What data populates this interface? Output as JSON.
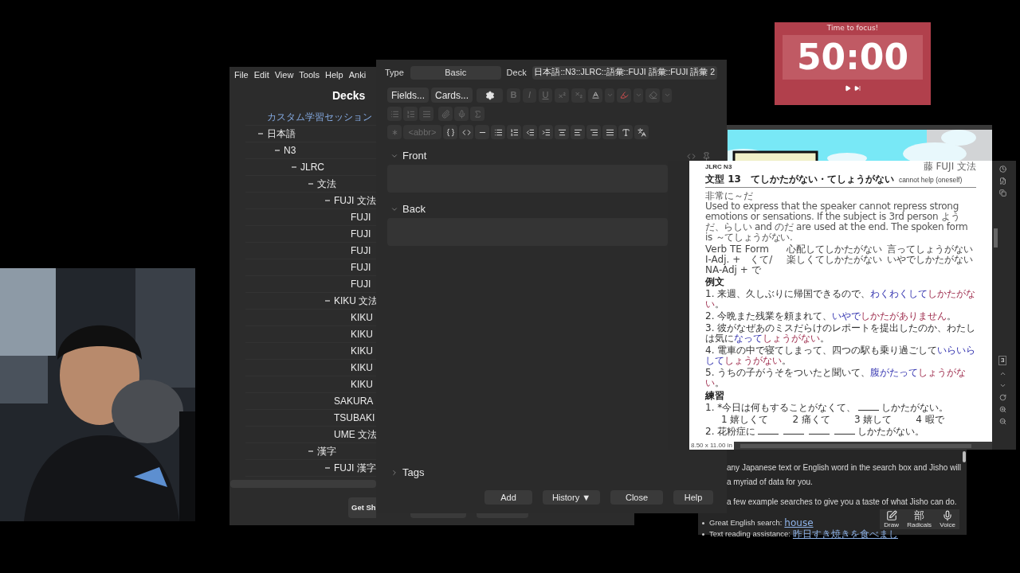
{
  "deck_browser": {
    "menu": [
      "File",
      "Edit",
      "View",
      "Tools",
      "Help",
      "Anki"
    ],
    "title": "Decks",
    "tree": [
      {
        "name": "カスタム学習セッション",
        "kind": "filtered"
      },
      {
        "name": "日本語",
        "kind": "deck",
        "expanded": true,
        "children": [
          {
            "name": "N3",
            "kind": "deck",
            "expanded": true,
            "children": [
              {
                "name": "JLRC",
                "kind": "deck",
                "expanded": true,
                "children": [
                  {
                    "name": "文法",
                    "kind": "deck",
                    "expanded": true,
                    "children": [
                      {
                        "name": "FUJI 文法",
                        "kind": "deck",
                        "expanded": true,
                        "children": [
                          {
                            "name": "FUJI",
                            "kind": "deck"
                          },
                          {
                            "name": "FUJI",
                            "kind": "deck"
                          },
                          {
                            "name": "FUJI",
                            "kind": "deck"
                          },
                          {
                            "name": "FUJI",
                            "kind": "deck"
                          },
                          {
                            "name": "FUJI",
                            "kind": "deck"
                          }
                        ]
                      },
                      {
                        "name": "KIKU 文法",
                        "kind": "deck",
                        "expanded": true,
                        "children": [
                          {
                            "name": "KIKU",
                            "kind": "deck"
                          },
                          {
                            "name": "KIKU",
                            "kind": "deck"
                          },
                          {
                            "name": "KIKU",
                            "kind": "deck"
                          },
                          {
                            "name": "KIKU",
                            "kind": "deck"
                          },
                          {
                            "name": "KIKU",
                            "kind": "deck"
                          }
                        ]
                      },
                      {
                        "name": "SAKURA",
                        "kind": "deck"
                      },
                      {
                        "name": "TSUBAKI",
                        "kind": "deck"
                      },
                      {
                        "name": "UME 文法",
                        "kind": "deck"
                      }
                    ]
                  },
                  {
                    "name": "漢字",
                    "kind": "deck",
                    "expanded": true,
                    "children": [
                      {
                        "name": "FUJI 漢字",
                        "kind": "deck",
                        "expanded": true
                      }
                    ]
                  }
                ]
              }
            ]
          }
        ]
      }
    ],
    "buttons": [
      "Get Sh"
    ]
  },
  "add_card": {
    "type_label": "Type",
    "note_type": "Basic",
    "deck_label": "Deck",
    "deck": "日本語::N3::JLRC::語彙::FUJI 語彙::FUJI 語彙 2",
    "toolbar": {
      "buttons": [
        "Fields...",
        "Cards..."
      ],
      "format_letters": [
        "B",
        "I",
        "U"
      ],
      "abbr": "<abbr>"
    },
    "fields": [
      {
        "name": "Front",
        "expanded": true
      },
      {
        "name": "Back",
        "expanded": true
      }
    ],
    "tags": {
      "label": "Tags",
      "expanded": false
    },
    "actions": [
      "Add",
      "History ▼",
      "Close",
      "Help"
    ]
  },
  "pdf_viewer": {
    "header_left": "JLRC N3",
    "header_right": "藤 FUJI 文法",
    "title": "文型 13　てしかたがない・てしょうがない",
    "title_gloss": "cannot help (oneself)",
    "meaning": "非常に～だ",
    "explanation": "Used to express that the speaker cannot repress strong emotions or sensations. If the subject is 3rd person ようだ、らしい and のだ are used at the end. The spoken form is ～てしょうがない.",
    "forms": [
      [
        "Verb TE Form",
        "心配してしかたがない",
        "言ってしょうがない"
      ],
      [
        "I-Adj. +　くて/ NA-Adj + で",
        "楽しくてしかたがない",
        "いやでしかたがない"
      ]
    ],
    "examples_heading": "例文",
    "examples": [
      {
        "number": "1.",
        "text": "来週、久しぶりに帰国できるので、",
        "emphasis": "わくわくして",
        "pattern": "しかたがない",
        "end": "。"
      },
      {
        "number": "2.",
        "text": "今晩また残業を頼まれて、",
        "emphasis": "いやで",
        "pattern": "しかたがありません",
        "end": "。"
      },
      {
        "number": "3.",
        "text": "彼がなぜあのミスだらけのレポートを提出したのか、わたしは気に",
        "emphasis": "なって",
        "pattern": "しょうがない",
        "end": "。"
      },
      {
        "number": "4.",
        "text": "電車の中で寝てしまって、四つの駅も乗り過ごして",
        "emphasis": "いらいらして",
        "pattern": "しょうがない",
        "end": "。"
      },
      {
        "number": "5.",
        "text": "うちの子がうそをついたと聞いて、",
        "emphasis": "腹がたって",
        "pattern": "しょうがない",
        "end": "。"
      }
    ],
    "practice_heading": "練習",
    "exercises": [
      {
        "number": "1.",
        "parts": [
          {
            "kind": "text",
            "text": "*今日は何もすることがなくて、"
          },
          {
            "kind": "blank"
          },
          {
            "kind": "text",
            "text": "しかたがない。"
          }
        ],
        "options": [
          "1 嬉しくて",
          "2 痛くて",
          "3 嬉して",
          "4 暇で"
        ]
      },
      {
        "number": "2.",
        "parts": [
          {
            "kind": "text",
            "text": "花粉症に"
          },
          {
            "kind": "blank"
          },
          {
            "kind": "blank"
          },
          {
            "kind": "blank"
          },
          {
            "kind": "blank"
          },
          {
            "kind": "text",
            "text": "しかたがない。"
          }
        ]
      }
    ],
    "page_size": "8.50 x 11.00 in",
    "page_number": "3"
  },
  "timer": {
    "heading": "Time to focus!",
    "time": "50:00"
  },
  "jisho": {
    "paragraphs": [
      "any Japanese text or English word in the search box and Jisho will",
      "a myriad of data for you.",
      "a few example searches to give you a taste of what Jisho can do."
    ],
    "examples": [
      {
        "label": "Great English search:",
        "link": "house"
      },
      {
        "label": "Text reading assistance:",
        "link": "昨日すき焼きを食べまし"
      }
    ],
    "input_tools": [
      {
        "kind": "draw",
        "label": "Draw"
      },
      {
        "kind": "radicals",
        "glyph": "部",
        "label": "Radicals"
      },
      {
        "kind": "voice",
        "label": "Voice"
      }
    ]
  }
}
